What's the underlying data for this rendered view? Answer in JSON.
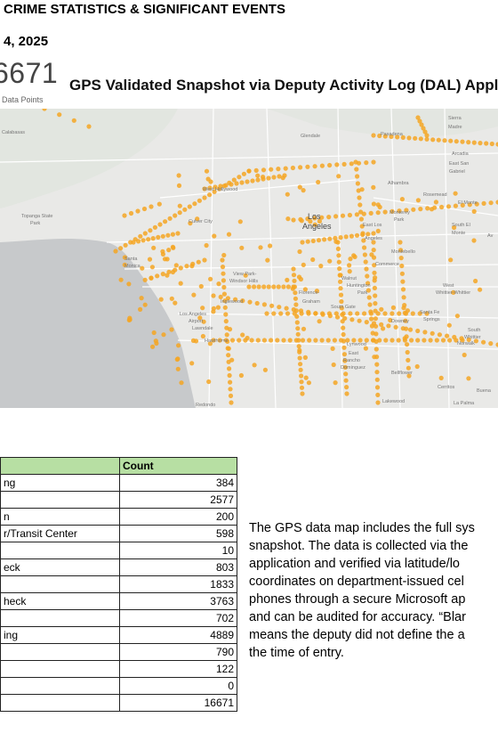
{
  "header": {
    "title": "CRIME STATISTICS & SIGNIFICANT EVENTS",
    "date": "4, 2025"
  },
  "kpi": {
    "value": "6671",
    "caption": "Data Points"
  },
  "map": {
    "title": "GPS Validated Snapshot via Deputy Activity Log (DAL) Applica",
    "point_color": "#f5a623",
    "labels": [
      {
        "id": "calabasas",
        "text": "Calabasas"
      },
      {
        "id": "glendale",
        "text": "Glendale"
      },
      {
        "id": "pasadena",
        "text": "Pasadena"
      },
      {
        "id": "sierra",
        "text": "Sierra"
      },
      {
        "id": "madre",
        "text": "Madre"
      },
      {
        "id": "arcadia",
        "text": "Arcadia"
      },
      {
        "id": "eastsan",
        "text": "East San"
      },
      {
        "id": "gabriel",
        "text": "Gabriel"
      },
      {
        "id": "alhambra",
        "text": "Alhambra"
      },
      {
        "id": "rosemead",
        "text": "Rosemead"
      },
      {
        "id": "elmonte",
        "text": "El Monte"
      },
      {
        "id": "monterey",
        "text": "Monterey"
      },
      {
        "id": "park",
        "text": "Park"
      },
      {
        "id": "southel",
        "text": "South El"
      },
      {
        "id": "monte2",
        "text": "Monte"
      },
      {
        "id": "los",
        "text": "Los"
      },
      {
        "id": "angeles",
        "text": "Angeles"
      },
      {
        "id": "eastla",
        "text": "East Los"
      },
      {
        "id": "angeles2",
        "text": "Angeles"
      },
      {
        "id": "montebello",
        "text": "Montebello"
      },
      {
        "id": "westhollywood",
        "text": "West Hollywood"
      },
      {
        "id": "culver",
        "text": "Culver City"
      },
      {
        "id": "santa",
        "text": "Santa"
      },
      {
        "id": "monica",
        "text": "Monica"
      },
      {
        "id": "topanga",
        "text": "Topanga State"
      },
      {
        "id": "tpark",
        "text": "Park"
      },
      {
        "id": "viewpark",
        "text": "View Park-"
      },
      {
        "id": "windsor",
        "text": "Windsor Hills"
      },
      {
        "id": "inglewood",
        "text": "Inglewood"
      },
      {
        "id": "florence",
        "text": "Florence-"
      },
      {
        "id": "graham",
        "text": "Graham"
      },
      {
        "id": "huntington",
        "text": "Huntington"
      },
      {
        "id": "hpark",
        "text": "Park"
      },
      {
        "id": "walnut",
        "text": "Walnut"
      },
      {
        "id": "commerce",
        "text": "Commerce"
      },
      {
        "id": "southgate",
        "text": "South Gate"
      },
      {
        "id": "westwhittier",
        "text": "West"
      },
      {
        "id": "whittier2",
        "text": "Whittier-Whittier"
      },
      {
        "id": "santafe",
        "text": "Santa Fe"
      },
      {
        "id": "springs",
        "text": "Springs"
      },
      {
        "id": "downey",
        "text": "Downey"
      },
      {
        "id": "norwalk",
        "text": "Norwalk"
      },
      {
        "id": "south",
        "text": "South"
      },
      {
        "id": "whittier3",
        "text": "Whittier"
      },
      {
        "id": "lawindale",
        "text": "Lawndale"
      },
      {
        "id": "hawthorne",
        "text": "Hawthorne"
      },
      {
        "id": "lynwood",
        "text": "Lynwood"
      },
      {
        "id": "east",
        "text": "East"
      },
      {
        "id": "rancho",
        "text": "Rancho"
      },
      {
        "id": "dominguez",
        "text": "Dominguez"
      },
      {
        "id": "bellflower",
        "text": "Bellflower"
      },
      {
        "id": "cerritos",
        "text": "Cerritos"
      },
      {
        "id": "buena",
        "text": "Buena"
      },
      {
        "id": "redondo",
        "text": "Redondo"
      },
      {
        "id": "lakewood",
        "text": "Lakewood"
      },
      {
        "id": "lapalma",
        "text": "La Palma"
      },
      {
        "id": "ladera",
        "text": "Los Angeles"
      },
      {
        "id": "airport",
        "text": "Airport"
      },
      {
        "id": "avo",
        "text": "Av"
      }
    ]
  },
  "table": {
    "header": [
      "",
      "Count"
    ],
    "rows": [
      {
        "label": "ng",
        "count": "384"
      },
      {
        "label": "",
        "count": "2577"
      },
      {
        "label": "n",
        "count": "200"
      },
      {
        "label": "r/Transit Center",
        "count": "598"
      },
      {
        "label": "",
        "count": "10"
      },
      {
        "label": "eck",
        "count": "803"
      },
      {
        "label": "",
        "count": "1833"
      },
      {
        "label": "heck",
        "count": "3763"
      },
      {
        "label": "",
        "count": "702"
      },
      {
        "label": "ing",
        "count": "4889"
      },
      {
        "label": "",
        "count": "790"
      },
      {
        "label": "",
        "count": "122"
      },
      {
        "label": "",
        "count": "0"
      },
      {
        "label": "",
        "count": "16671"
      }
    ]
  },
  "paragraph": {
    "lines": [
      "The GPS data map includes the full sys",
      "snapshot. The data is collected via the",
      "application and verified via latitude/lo",
      "coordinates on department-issued cel",
      "phones through a secure Microsoft ap",
      "and can be audited for accuracy. “Blar",
      "means the deputy did not define the a",
      "the time of entry."
    ]
  }
}
